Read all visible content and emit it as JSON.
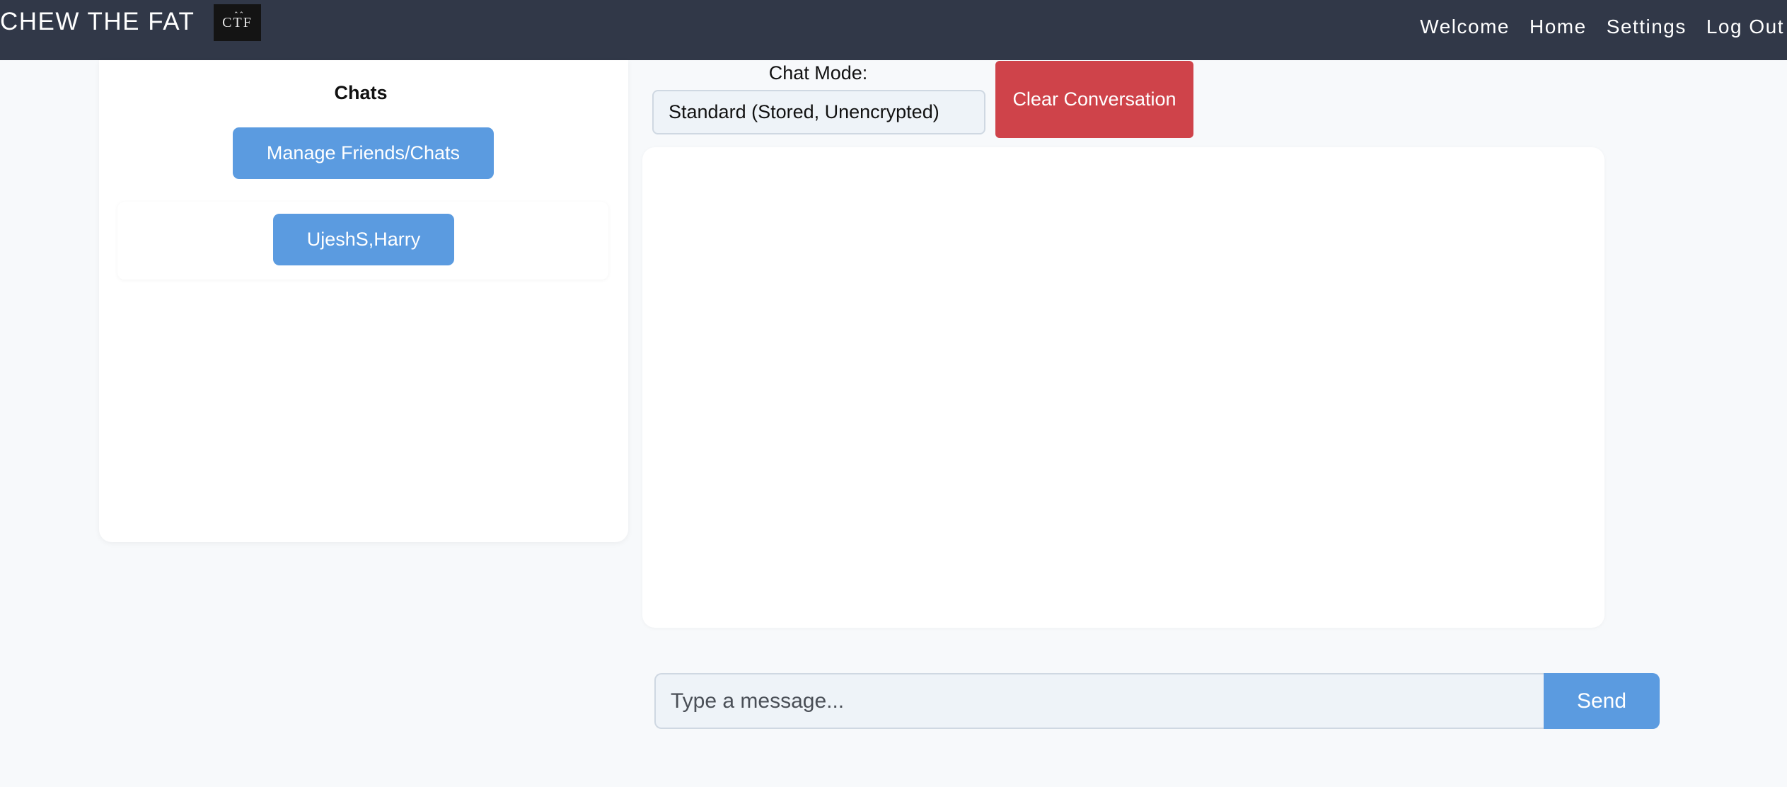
{
  "navbar": {
    "brand": "CHEW THE FAT",
    "logo_text": "CTF",
    "links": [
      "Welcome",
      "Home",
      "Settings",
      "Log Out"
    ]
  },
  "sidebar": {
    "title": "Chats",
    "manage_button": "Manage Friends/Chats",
    "chats": [
      "UjeshS,Harry"
    ]
  },
  "chat": {
    "mode_label": "Chat Mode:",
    "mode_selected": "Standard (Stored, Unencrypted)",
    "clear_button": "Clear Conversation",
    "input_placeholder": "Type a message...",
    "send_button": "Send"
  },
  "colors": {
    "navbar_bg": "#313848",
    "primary_button": "#5b9be0",
    "danger_button": "#cf434a",
    "page_bg": "#f7f9fb"
  }
}
